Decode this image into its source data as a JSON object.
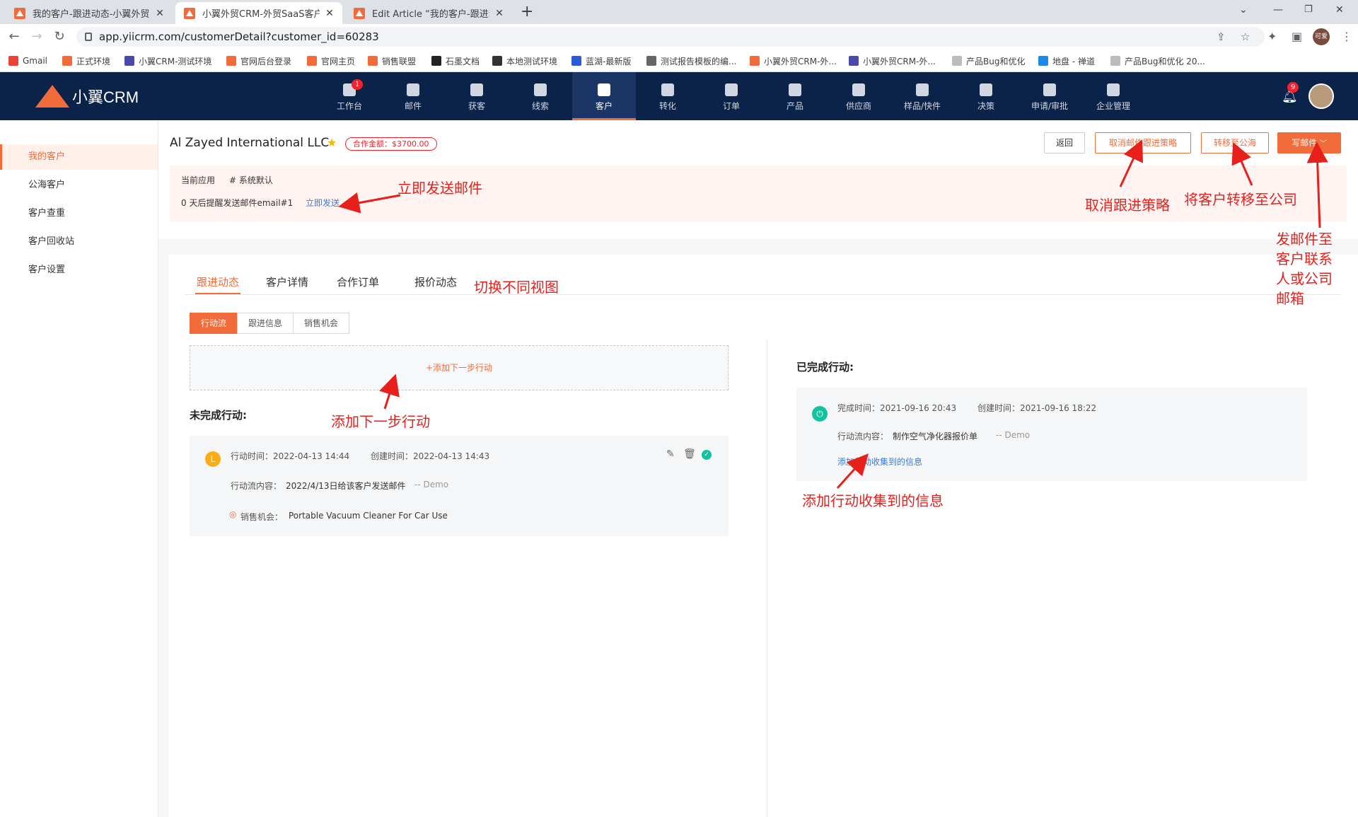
{
  "browser": {
    "tabs": [
      {
        "title": "我的客户-跟进动态-小翼外贸CRM"
      },
      {
        "title": "小翼外贸CRM-外贸SaaS客户管理"
      },
      {
        "title": "Edit Article “我的客户-跟进动态"
      }
    ],
    "url": "app.yiicrm.com/customerDetail?customer_id=60283",
    "profile_label": "可爱",
    "bookmarks": [
      {
        "label": "Gmail",
        "color": "#ea4335"
      },
      {
        "label": "正式环境",
        "color": "#f26b3a"
      },
      {
        "label": "小翼CRM-测试环境",
        "color": "#4a4aa8"
      },
      {
        "label": "官网后台登录",
        "color": "#f26b3a"
      },
      {
        "label": "官网主页",
        "color": "#f26b3a"
      },
      {
        "label": "销售联盟",
        "color": "#f26b3a"
      },
      {
        "label": "石墨文档",
        "color": "#222222"
      },
      {
        "label": "本地测试环境",
        "color": "#333333"
      },
      {
        "label": "蓝湖-最新版",
        "color": "#2a5bd7"
      },
      {
        "label": "测试报告模板的编...",
        "color": "#666666"
      },
      {
        "label": "小翼外贸CRM-外...",
        "color": "#f26b3a"
      },
      {
        "label": "小翼外贸CRM-外...",
        "color": "#4a4aa8"
      },
      {
        "label": "产品Bug和优化",
        "color": "#bbbbbb"
      },
      {
        "label": "地盘 - 禅道",
        "color": "#1e88e5"
      },
      {
        "label": "产品Bug和优化 20...",
        "color": "#bbbbbb"
      }
    ]
  },
  "app": {
    "logo_text": "小翼CRM",
    "nav": [
      {
        "label": "工作台",
        "badge": "1"
      },
      {
        "label": "邮件"
      },
      {
        "label": "获客"
      },
      {
        "label": "线索"
      },
      {
        "label": "客户",
        "active": true
      },
      {
        "label": "转化"
      },
      {
        "label": "订单"
      },
      {
        "label": "产品"
      },
      {
        "label": "供应商"
      },
      {
        "label": "样品/快件"
      },
      {
        "label": "决策"
      },
      {
        "label": "申请/审批"
      },
      {
        "label": "企业管理"
      }
    ],
    "notify_badge": "9"
  },
  "sidebar": {
    "items": [
      {
        "label": "我的客户",
        "active": true
      },
      {
        "label": "公海客户"
      },
      {
        "label": "客户查重"
      },
      {
        "label": "客户回收站"
      },
      {
        "label": "客户设置"
      }
    ]
  },
  "customer": {
    "name": "Al Zayed International LLC",
    "amount_tag": "合作金额：$3700.00"
  },
  "actions": {
    "back": "返回",
    "cancel_strategy": "取消邮件跟进策略",
    "move_public": "转移至公海",
    "write_email": "写邮件"
  },
  "strategy": {
    "applied_label": "当前应用",
    "applied_value": "# 系统默认",
    "reminder_text": "0 天后提醒发送邮件email#1",
    "send_now": "立即发送"
  },
  "content_tabs": [
    {
      "label": "跟进动态",
      "active": true
    },
    {
      "label": "客户详情"
    },
    {
      "label": "合作订单"
    },
    {
      "label": "报价动态"
    }
  ],
  "segments": [
    {
      "label": "行动流",
      "active": true
    },
    {
      "label": "跟进信息"
    },
    {
      "label": "销售机会"
    }
  ],
  "add_next_action": "+添加下一步行动",
  "pending": {
    "title": "未完成行动:",
    "action_time": "行动时间：2022-04-13 14:44",
    "created_time": "创建时间：2022-04-13 14:43",
    "content_label": "行动流内容：",
    "content": "2022/4/13日给该客户发送邮件",
    "demo": "-- Demo",
    "opportunity_label": "销售机会：",
    "opportunity": "Portable Vacuum Cleaner For Car Use"
  },
  "completed": {
    "title": "已完成行动:",
    "done_time": "完成时间：2021-09-16 20:43",
    "created_time": "创建时间：2021-09-16 18:22",
    "content_label": "行动流内容：",
    "content": "制作空气净化器报价单",
    "demo": "-- Demo",
    "add_info_link": "添加行动收集到的信息"
  },
  "annotations": {
    "send_now": "立即发送邮件",
    "cancel_strategy": "取消跟进策略",
    "move": "将客户转移至公司",
    "email": [
      "发邮件至",
      "客户联系",
      "人或公司",
      "邮箱"
    ],
    "switch_view": "切换不同视图",
    "add_next": "添加下一步行动",
    "add_info": "添加行动收集到的信息"
  },
  "colors": {
    "brand": "#f26b3a",
    "header": "#0b2249",
    "annotation": "#e8201c",
    "link": "#3a7bd5",
    "success": "#13c2c2",
    "pending": "#faad14"
  }
}
